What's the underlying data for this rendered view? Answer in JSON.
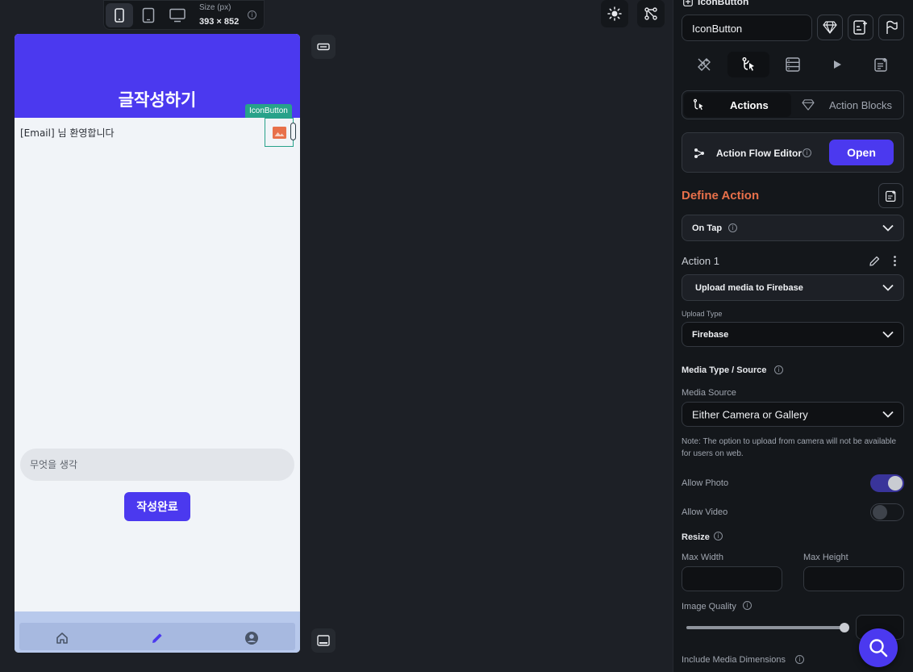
{
  "toolbar": {
    "size_label": "Size (px)",
    "size_value": "393 × 852"
  },
  "phone": {
    "title": "글작성하기",
    "welcome_text": "[Email] 님 환영합니다",
    "input_placeholder": "무엇을 생각",
    "submit_label": "작성완료",
    "nav_items": [
      "home-icon",
      "edit-icon",
      "account-icon"
    ]
  },
  "selection": {
    "tag_label": "IconButton"
  },
  "panel": {
    "widget_title": "IconButton",
    "widget_name_value": "IconButton",
    "tabs": [
      "properties",
      "actions",
      "backend-query",
      "preview",
      "documentation"
    ],
    "subtabs": {
      "actions_label": "Actions",
      "action_blocks_label": "Action Blocks"
    },
    "flow_editor": {
      "label": "Action Flow Editor",
      "open_label": "Open"
    },
    "define_action_label": "Define Action",
    "trigger_value": "On Tap",
    "action_title": "Action 1",
    "action_type_value": "Upload media to Firebase",
    "upload_type_label": "Upload Type",
    "upload_type_value": "Firebase",
    "media_type_label": "Media Type / Source",
    "media_source_label": "Media Source",
    "media_source_value": "Either Camera or Gallery",
    "note_text": "Note: The option to upload from camera will not be available for users on web.",
    "allow_photo_label": "Allow Photo",
    "allow_photo_on": true,
    "allow_video_label": "Allow Video",
    "allow_video_on": false,
    "resize_label": "Resize",
    "max_width_label": "Max Width",
    "max_width_value": "",
    "max_height_label": "Max Height",
    "max_height_value": "",
    "image_quality_label": "Image Quality",
    "image_quality_level": 1.0,
    "image_quality_value": "",
    "include_dimensions_label": "Include Media Dimensions"
  },
  "colors": {
    "primary": "#4b39ef",
    "accent_orange": "#e8704a",
    "teal": "#27a28a",
    "panel_bg": "#14171b",
    "canvas_bg": "#1d2026"
  }
}
